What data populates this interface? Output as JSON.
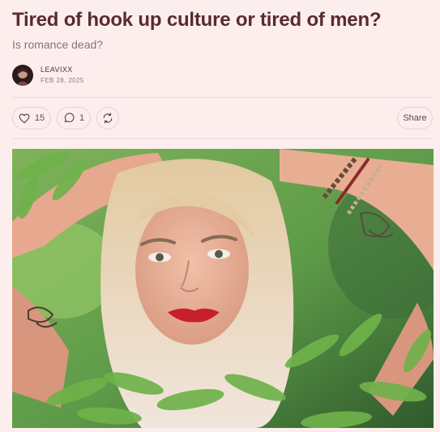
{
  "post": {
    "title": "Tired of hook up culture or tired of men?",
    "subtitle": "Is romance dead?"
  },
  "byline": {
    "author": "LEAVIXX",
    "date": "FEB 28, 2025"
  },
  "actions": {
    "likes": "15",
    "comments": "1",
    "share_label": "Share",
    "like_icon": "heart-icon",
    "comment_icon": "comment-bubble-icon",
    "restack_icon": "restack-icon"
  },
  "colors": {
    "background": "#fdeeee",
    "title": "#5a2a2f",
    "muted": "#8a7375",
    "border": "#e6d2d3"
  }
}
